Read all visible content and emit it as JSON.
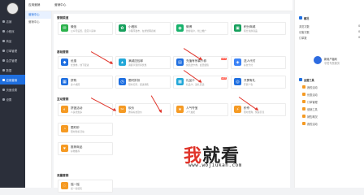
{
  "sidebar": {
    "items": [
      {
        "label": "店铺",
        "icon": "home-icon"
      },
      {
        "label": "小程序",
        "icon": "miniapp-icon"
      },
      {
        "label": "商品",
        "icon": "goods-icon"
      },
      {
        "label": "订单管理",
        "icon": "order-icon"
      },
      {
        "label": "会员管理",
        "icon": "member-icon"
      },
      {
        "label": "数据",
        "icon": "data-icon"
      },
      {
        "label": "应用营销",
        "icon": "marketing-icon",
        "active": true
      },
      {
        "label": "页面设置",
        "icon": "page-icon"
      },
      {
        "label": "设置",
        "icon": "settings-icon"
      }
    ]
  },
  "subnav": {
    "title": "应用营销",
    "items": [
      {
        "label": "营销中心",
        "active": true
      },
      {
        "label": "营销中心"
      }
    ]
  },
  "topbar": {
    "crumb": "营销中心"
  },
  "sections": [
    {
      "title": "营销渠道",
      "cards": [
        {
          "name": "微信",
          "desc": "公众号设置，自定义菜单",
          "color": "#2bb24c",
          "glyph": "✉"
        },
        {
          "name": "小程序",
          "desc": "小程序发布，在线管理商城",
          "color": "#17a05d",
          "glyph": "✿"
        },
        {
          "name": "微博",
          "desc": "微博商户，线上推广",
          "color": "#17b26b",
          "glyph": "◉"
        },
        {
          "name": "积分商城",
          "desc": "积分兑换商品",
          "color": "#17a05d",
          "glyph": "▣"
        }
      ]
    },
    {
      "title": "基础营销",
      "cards": [
        {
          "name": "优惠",
          "desc": "优惠券，线下促进",
          "color": "#1f6fe0",
          "glyph": "◆"
        },
        {
          "name": "满减送包邮",
          "desc": "满额享受折扣优惠",
          "color": "#22a7d8",
          "glyph": "▲"
        },
        {
          "name": "充值有惊喜卡券",
          "desc": "充值送卡券，会员储值",
          "color": "#1f6fe0",
          "glyph": "▤",
          "hot": "HOT"
        },
        {
          "name": "送人代付",
          "desc": "好友代付",
          "color": "#3b82f6",
          "glyph": "◈"
        },
        {
          "name": "拼购",
          "desc": "多人成团",
          "color": "#1f6fe0",
          "glyph": "▦"
        },
        {
          "name": "限时折扣",
          "desc": "限时打折，促进销售",
          "color": "#1f6fe0",
          "glyph": "◷"
        },
        {
          "name": "礼品卡",
          "desc": "礼品卡，送礼首选",
          "color": "#22a7d8",
          "glyph": "▩",
          "hot": "HOT"
        },
        {
          "name": "开屏有礼",
          "desc": "开屏广告",
          "color": "#1f6fe0",
          "glyph": "◎"
        }
      ]
    },
    {
      "title": "互动营销",
      "cards": [
        {
          "name": "拼团活动",
          "desc": "人多优惠多",
          "color": "#f59a23",
          "glyph": "◐"
        },
        {
          "name": "砍价",
          "desc": "邀请好友砍价",
          "color": "#f59a23",
          "glyph": "✂"
        },
        {
          "name": "人气夺宝",
          "desc": "人气抽奖",
          "color": "#f59a23",
          "glyph": "★"
        },
        {
          "name": "秒杀",
          "desc": "限时抢购，快速引流",
          "color": "#f59a23",
          "glyph": "⚡"
        },
        {
          "name": "限时秒",
          "desc": "限时秒杀活动",
          "color": "#f59a23",
          "glyph": "◔"
        },
        {
          "name": "推荐商品",
          "desc": "好物推荐",
          "color": "#f59a23",
          "glyph": "♥"
        }
      ]
    },
    {
      "title": "流量营销",
      "cards": [
        {
          "name": "摇一摇",
          "desc": "摇一摇领奖",
          "color": "#f59a23",
          "glyph": "◌"
        }
      ]
    }
  ],
  "right_panel": {
    "title": "概况",
    "stats": [
      {
        "label": "浏览次数",
        "value": "0"
      },
      {
        "label": "访客次数",
        "value": "0"
      },
      {
        "label": "订单数",
        "value": "0"
      }
    ],
    "promo_title": "新用户福利",
    "promo_desc": "享受专属服务",
    "guide_title": "运营工具",
    "guide_items": [
      "我的活动",
      "优惠活动",
      "订单管理",
      "营销工具",
      "销售概况",
      "我的活动"
    ]
  },
  "watermark": {
    "chars": [
      "我",
      "就",
      "看"
    ],
    "url": "www.wojiukan.com"
  }
}
